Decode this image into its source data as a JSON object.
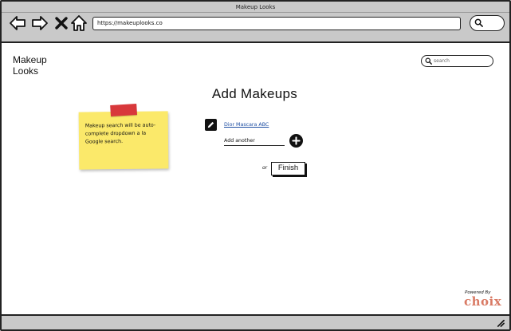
{
  "window": {
    "title": "Makeup Looks"
  },
  "browser": {
    "url": "https://makeuplooks.co",
    "icons": [
      "arrow-left-icon",
      "arrow-right-icon",
      "close-icon",
      "home-icon",
      "search-icon"
    ]
  },
  "header": {
    "brand": "Makeup Looks",
    "search_placeholder": "search"
  },
  "main": {
    "title": "Add Makeups",
    "sticky_note": "Makeup search will be auto-complete dropdown a la Google search.",
    "makeup_item": "Dior Mascara ABC",
    "add_another_value": "Add another",
    "or_label": "or",
    "finish_label": "Finish"
  },
  "footer": {
    "powered_by": "Powered By",
    "brand": "choix"
  },
  "colors": {
    "chrome": "#c9c9c9",
    "sticky": "#fbe96a",
    "tape": "#d8383b",
    "link": "#1f4fa3",
    "choix": "#d97a64"
  }
}
